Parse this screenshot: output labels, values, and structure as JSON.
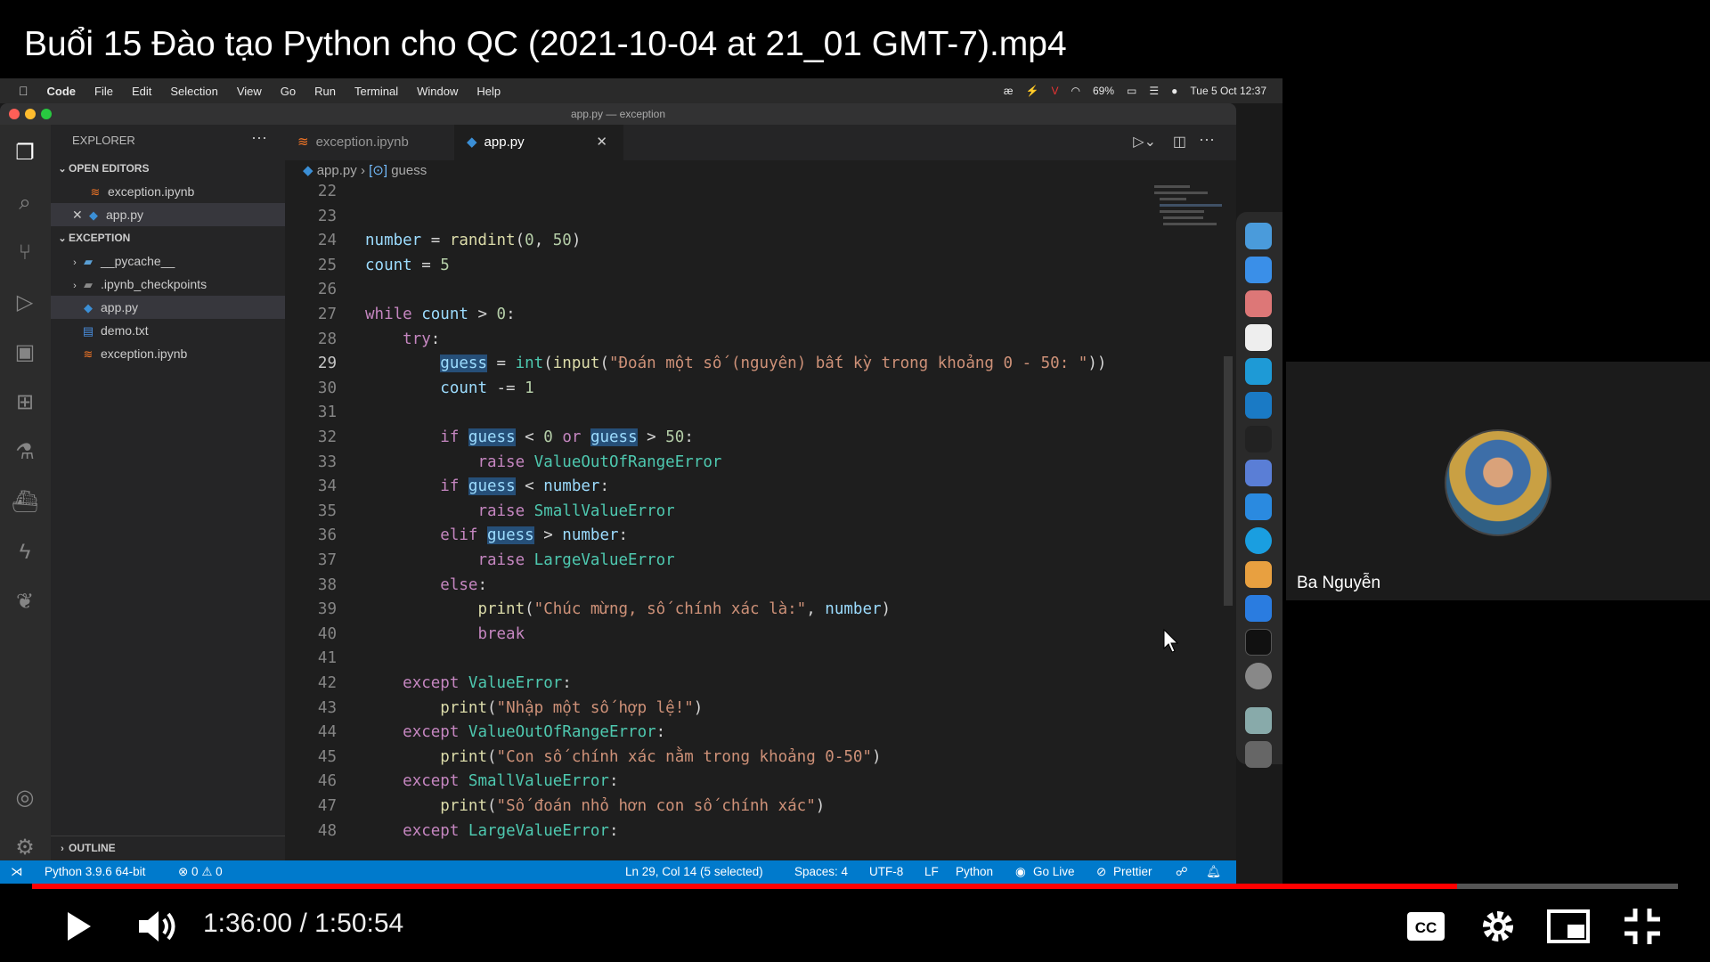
{
  "video": {
    "title": "Buổi 15 Đào tạo Python cho QC (2021-10-04 at 21_01 GMT-7).mp4",
    "current_time": "1:36:00",
    "separator": "/",
    "duration": "1:50:54",
    "progress": 0.866
  },
  "mac_menubar": {
    "app": "Code",
    "items": [
      "File",
      "Edit",
      "Selection",
      "View",
      "Go",
      "Run",
      "Terminal",
      "Window",
      "Help"
    ],
    "battery": "69%",
    "datetime": "Tue 5 Oct  12:37"
  },
  "window": {
    "title": "app.py — exception"
  },
  "explorer": {
    "header": "EXPLORER",
    "open_editors_label": "OPEN EDITORS",
    "open_editors": [
      "exception.ipynb",
      "app.py"
    ],
    "folder_label": "EXCEPTION",
    "files": [
      "__pycache__",
      ".ipynb_checkpoints",
      "app.py",
      "demo.txt",
      "exception.ipynb"
    ],
    "outline_label": "OUTLINE"
  },
  "tabs": [
    "exception.ipynb",
    "app.py"
  ],
  "breadcrumb": {
    "file": "app.py",
    "symbol": "guess"
  },
  "code": {
    "current_line": 29,
    "lines": [
      {
        "n": "22",
        "html": ""
      },
      {
        "n": "23",
        "html": ""
      },
      {
        "n": "24",
        "html": "<span class='vr'>number</span> = <span class='fn'>randint</span>(<span class='nm'>0</span>, <span class='nm'>50</span>)"
      },
      {
        "n": "25",
        "html": "<span class='vr'>count</span> = <span class='nm'>5</span>"
      },
      {
        "n": "26",
        "html": ""
      },
      {
        "n": "27",
        "html": "<span class='kw'>while</span> <span class='vr'>count</span> &gt; <span class='nm'>0</span>:"
      },
      {
        "n": "28",
        "html": "    <span class='kw'>try</span>:"
      },
      {
        "n": "29",
        "html": "        <span class='hl'>guess</span> = <span class='cls'>int</span>(<span class='fn'>input</span>(<span class='st'>\"Đoán một số (nguyên) bất kỳ trong khoảng 0 - 50: \"</span>))"
      },
      {
        "n": "30",
        "html": "        <span class='vr'>count</span> -= <span class='nm'>1</span>"
      },
      {
        "n": "31",
        "html": ""
      },
      {
        "n": "32",
        "html": "        <span class='kw'>if</span> <span class='hl'>guess</span> &lt; <span class='nm'>0</span> <span class='kw'>or</span> <span class='hl'>guess</span> &gt; <span class='nm'>50</span>:"
      },
      {
        "n": "33",
        "html": "            <span class='kw'>raise</span> <span class='cls'>ValueOutOfRangeError</span>"
      },
      {
        "n": "34",
        "html": "        <span class='kw'>if</span> <span class='hl'>guess</span> &lt; <span class='vr'>number</span>:"
      },
      {
        "n": "35",
        "html": "            <span class='kw'>raise</span> <span class='cls'>SmallValueError</span>"
      },
      {
        "n": "36",
        "html": "        <span class='kw'>elif</span> <span class='hl'>guess</span> &gt; <span class='vr'>number</span>:"
      },
      {
        "n": "37",
        "html": "            <span class='kw'>raise</span> <span class='cls'>LargeValueError</span>"
      },
      {
        "n": "38",
        "html": "        <span class='kw'>else</span>:"
      },
      {
        "n": "39",
        "html": "            <span class='fn'>print</span>(<span class='st'>\"Chúc mừng, số chính xác là:\"</span>, <span class='vr'>number</span>)"
      },
      {
        "n": "40",
        "html": "            <span class='kw'>break</span>"
      },
      {
        "n": "41",
        "html": ""
      },
      {
        "n": "42",
        "html": "    <span class='kw'>except</span> <span class='cls'>ValueError</span>:"
      },
      {
        "n": "43",
        "html": "        <span class='fn'>print</span>(<span class='st'>\"Nhập một số hợp lệ!\"</span>)"
      },
      {
        "n": "44",
        "html": "    <span class='kw'>except</span> <span class='cls'>ValueOutOfRangeError</span>:"
      },
      {
        "n": "45",
        "html": "        <span class='fn'>print</span>(<span class='st'>\"Con số chính xác nằm trong khoảng 0-50\"</span>)"
      },
      {
        "n": "46",
        "html": "    <span class='kw'>except</span> <span class='cls'>SmallValueError</span>:"
      },
      {
        "n": "47",
        "html": "        <span class='fn'>print</span>(<span class='st'>\"Số đoán nhỏ hơn con số chính xác\"</span>)"
      },
      {
        "n": "48",
        "html": "    <span class='kw'>except</span> <span class='cls'>LargeValueError</span>:"
      }
    ]
  },
  "statusbar": {
    "python": "Python 3.9.6 64-bit",
    "problems": "⊗ 0 ⚠ 0",
    "position": "Ln 29, Col 14 (5 selected)",
    "spaces": "Spaces: 4",
    "encoding": "UTF-8",
    "eol": "LF",
    "language": "Python",
    "golive": "Go Live",
    "prettier": "Prettier"
  },
  "participant": {
    "name": "Ba Nguyễn"
  },
  "colors": {
    "accent_red": "#ff0000",
    "vscode_blue": "#007acc"
  }
}
